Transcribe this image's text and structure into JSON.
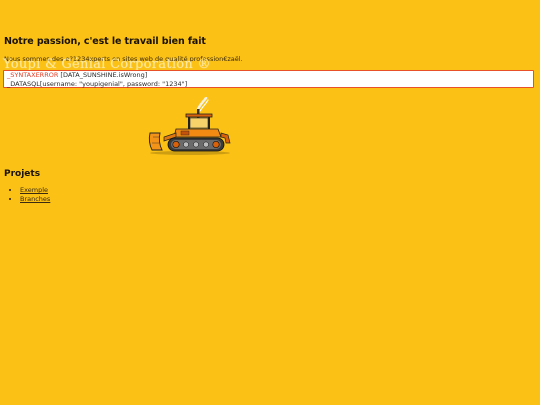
{
  "main": {
    "heading": "Notre passion, c'est le travail bien fait",
    "intro": "Nous sommes des e?1234xperts en sites web de qualité profession€zaël.",
    "brand_ghost": "Youpi & Génial Corporation ®"
  },
  "error_box": {
    "line1_error": "_SYNTAXERROR",
    "line1_rest": " [DATA_SUNSHINE.isWrong]",
    "line2": "_DATASQL[username: \"youpigenial\", password: \"1234\"]"
  },
  "projects": {
    "heading": "Projets",
    "items": [
      {
        "label": "Exemple"
      },
      {
        "label": "Branches"
      }
    ]
  },
  "colors": {
    "background": "#fbc115",
    "error_border": "#e8502a",
    "error_text": "#e0402a"
  },
  "icons": {
    "illustration": "bulldozer-icon"
  }
}
